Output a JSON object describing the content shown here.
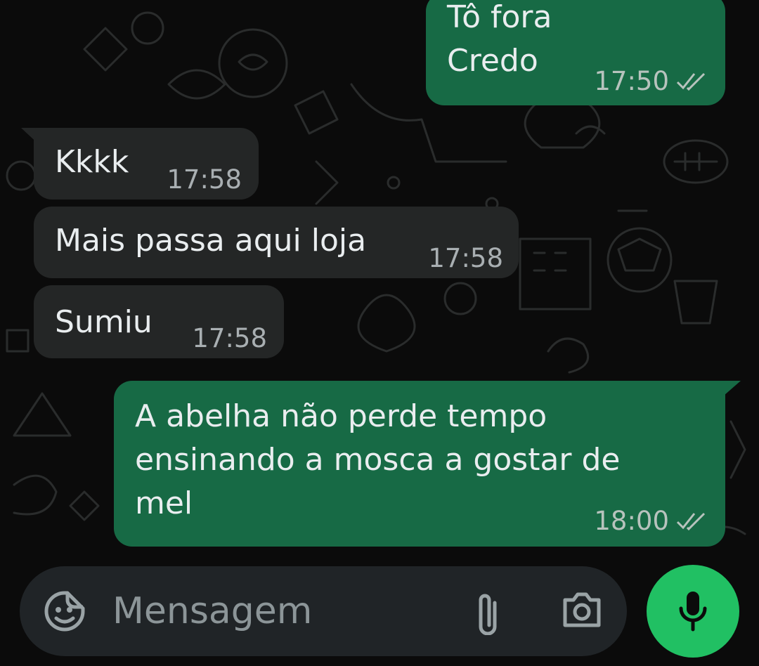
{
  "messages": [
    {
      "direction": "outgoing",
      "text": "Tô fora\nCredo",
      "time": "17:50",
      "status": "read"
    },
    {
      "direction": "incoming",
      "text": "Kkkk",
      "time": "17:58"
    },
    {
      "direction": "incoming",
      "text": "Mais passa aqui loja",
      "time": "17:58"
    },
    {
      "direction": "incoming",
      "text": "Sumiu",
      "time": "17:58"
    },
    {
      "direction": "outgoing",
      "text": "A abelha não perde tempo\nensinando a mosca a gostar de\nmel",
      "time": "18:00",
      "status": "read"
    }
  ],
  "composer": {
    "placeholder": "Mensagem",
    "left_icon": "sticker-icon",
    "right_icons": [
      "paperclip-icon",
      "camera-icon"
    ]
  },
  "mic_button": {
    "icon": "microphone-icon"
  },
  "colors": {
    "background": "#0b0b0b",
    "incoming_bubble": "#242626",
    "outgoing_bubble": "#176a45",
    "composer": "#202427",
    "accent": "#21c063"
  }
}
